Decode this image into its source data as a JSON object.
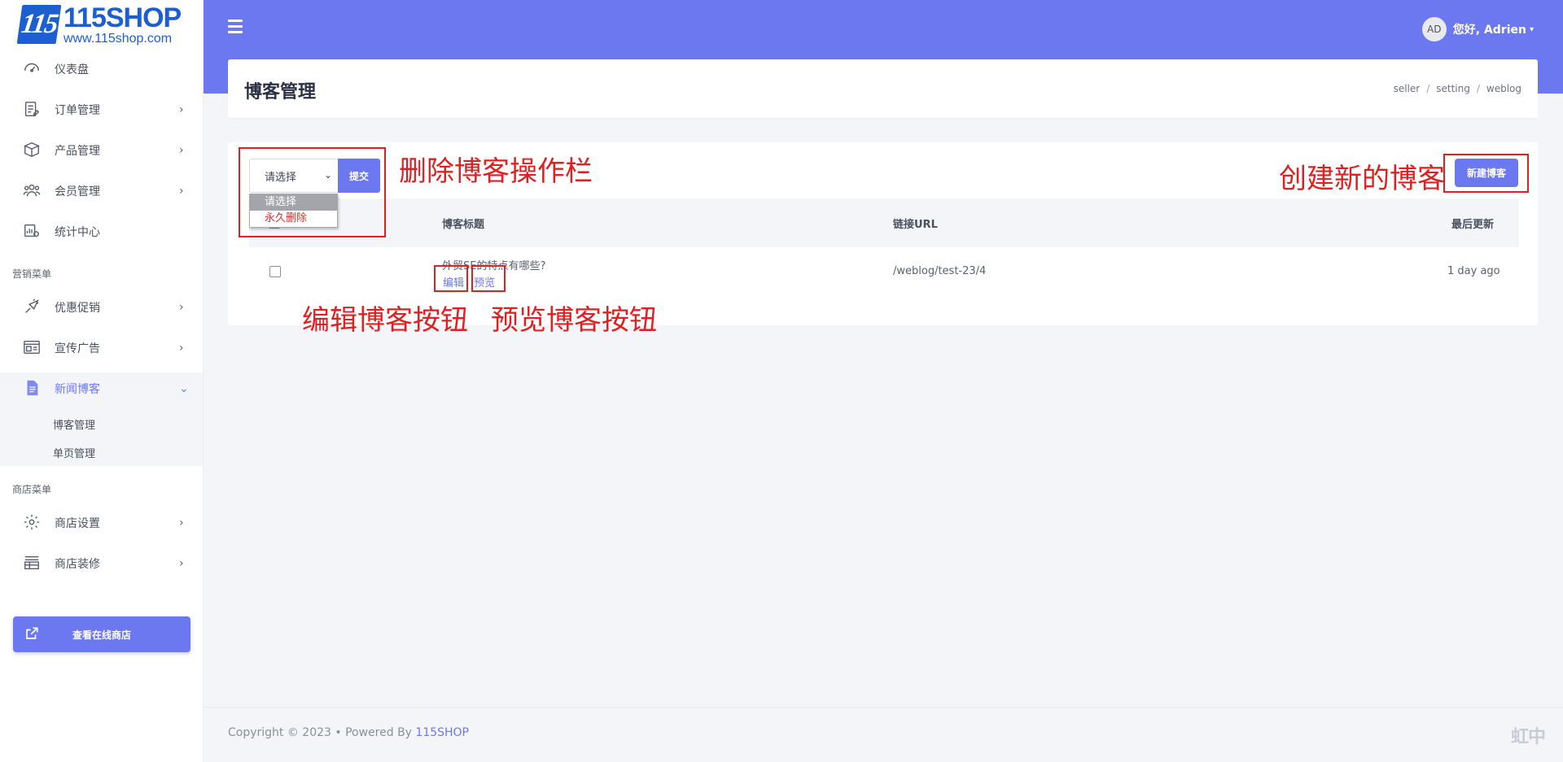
{
  "logo": {
    "mark": "115",
    "brand": "115SHOP",
    "url": "www.115shop.com"
  },
  "sidebar": {
    "items": [
      {
        "label": "仪表盘",
        "icon": "speedometer-icon"
      },
      {
        "label": "订单管理",
        "icon": "order-list-icon",
        "chevron": "›"
      },
      {
        "label": "产品管理",
        "icon": "box-icon",
        "chevron": "›"
      },
      {
        "label": "会员管理",
        "icon": "users-icon",
        "chevron": "›"
      },
      {
        "label": "统计中心",
        "icon": "stats-icon"
      }
    ],
    "section_marketing": "营销菜单",
    "marketing_items": [
      {
        "label": "优惠促销",
        "icon": "promo-icon",
        "chevron": "›"
      },
      {
        "label": "宣传广告",
        "icon": "ads-icon",
        "chevron": "›"
      },
      {
        "label": "新闻博客",
        "icon": "document-icon",
        "chevron": "⌄"
      }
    ],
    "sub_items": [
      "博客管理",
      "单页管理"
    ],
    "section_store": "商店菜单",
    "store_items": [
      {
        "label": "商店设置",
        "icon": "gear-icon",
        "chevron": "›"
      },
      {
        "label": "商店装修",
        "icon": "layout-icon",
        "chevron": "›"
      }
    ],
    "view_store_label": "查看在线商店"
  },
  "header": {
    "avatar": "AD",
    "greeting": "您好, Adrien",
    "caret": "▾"
  },
  "page": {
    "title": "博客管理",
    "breadcrumb": [
      "seller",
      "setting",
      "weblog"
    ],
    "breadcrumb_sep": "/"
  },
  "bulk": {
    "select_value": "请选择",
    "select_arrow": "⌄",
    "options": [
      "请选择",
      "永久删除"
    ],
    "submit_label": "提交"
  },
  "new_blog_label": "新建博客",
  "table": {
    "headers": [
      "博客标题",
      "链接URL",
      "最后更新"
    ],
    "rows": [
      {
        "title": "外贸SE的特点有哪些?",
        "edit": "编辑",
        "preview": "预览",
        "url": "/weblog/test-23/4",
        "updated": "1 day ago"
      }
    ]
  },
  "annotations": {
    "delete_bar": "删除博客操作栏",
    "create_new": "创建新的博客",
    "edit_btn": "编辑博客按钮",
    "preview_btn": "预览博客按钮"
  },
  "footer": {
    "copyright": "Copyright © 2023 • Powered By ",
    "brand": "115SHOP",
    "watermark": "虹中"
  },
  "colors": {
    "accent": "#6b78ef",
    "annotation": "#e02020",
    "danger": "#e0322a"
  }
}
